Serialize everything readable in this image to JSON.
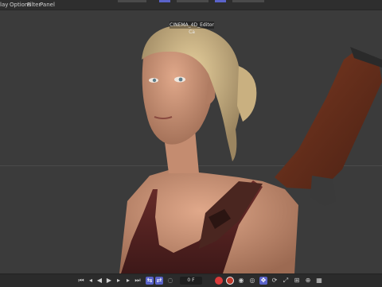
{
  "menu": {
    "items": [
      "lay",
      "Options",
      "Filter",
      "Panel"
    ]
  },
  "viewport": {
    "camera_label": "CINEMA_4D_Editor Ca"
  },
  "timeline": {
    "current_frame": "0 F"
  },
  "colors": {
    "accent": "#5a63c9",
    "record": "#d83a3a",
    "background": "#3a3a3a"
  },
  "icons": {
    "transport": [
      "go-to-start-icon",
      "previous-key-icon",
      "step-back-icon",
      "play-icon",
      "step-forward-icon",
      "next-key-icon",
      "go-to-end-icon"
    ],
    "right": [
      "record-icon",
      "autokey-icon",
      "keyframe-icon",
      "key-selection-icon",
      "move-key-icon",
      "rotate-key-icon",
      "scale-key-icon",
      "param-key-icon",
      "pla-key-icon",
      "grid-key-icon"
    ]
  }
}
